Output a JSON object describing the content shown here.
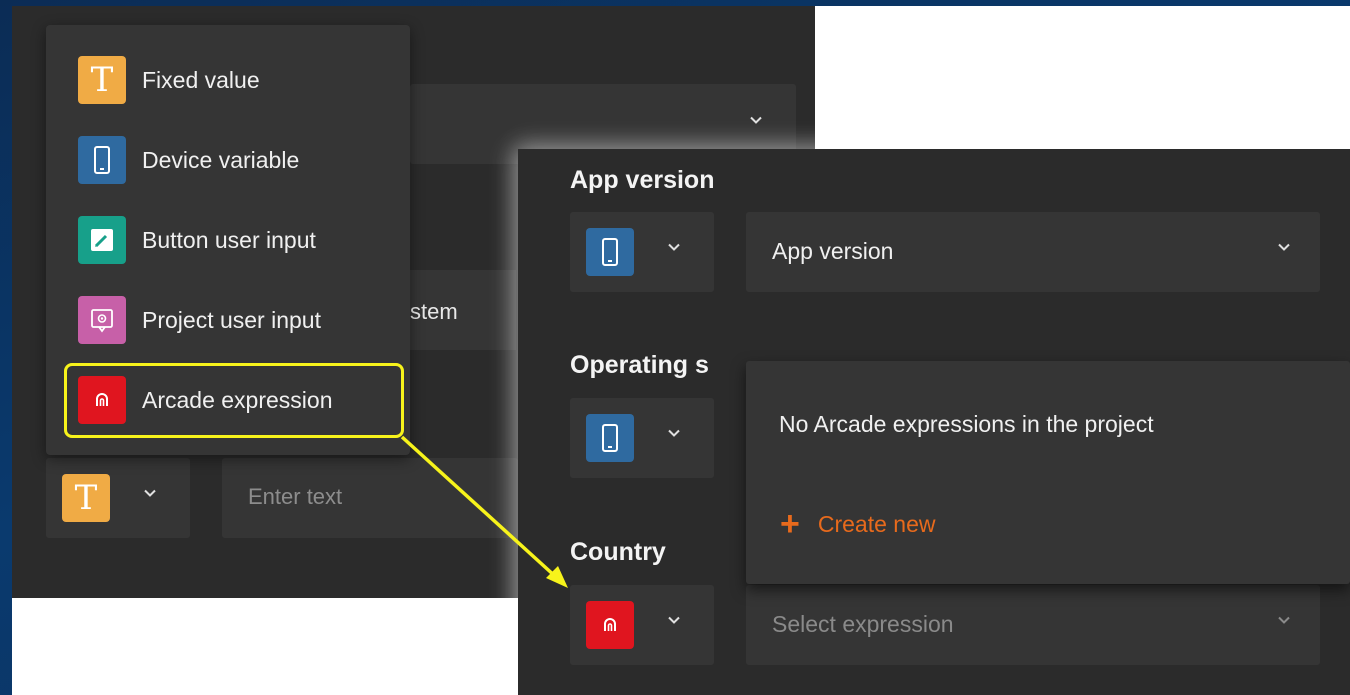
{
  "menu": {
    "items": [
      {
        "label": "Fixed value",
        "icon": "text-T-icon"
      },
      {
        "label": "Device variable",
        "icon": "phone-icon"
      },
      {
        "label": "Button user input",
        "icon": "pencil-icon"
      },
      {
        "label": "Project user input",
        "icon": "gear-screen-icon"
      },
      {
        "label": "Arcade expression",
        "icon": "arcade-icon"
      }
    ]
  },
  "background": {
    "partial_text": "stem",
    "input_placeholder": "Enter text"
  },
  "form": {
    "app_version": {
      "label": "App version",
      "value": "App version"
    },
    "operating_system": {
      "label": "Operating s"
    },
    "country": {
      "label": "Country",
      "placeholder": "Select expression"
    }
  },
  "dropdown": {
    "message": "No Arcade expressions in the project",
    "create_label": "Create new"
  },
  "colors": {
    "panel": "#2b2b2b",
    "field": "#353535",
    "fixed_value": "#f0ab45",
    "device_variable": "#2f6aa0",
    "button_user_input": "#17a08a",
    "project_user_input": "#c760a8",
    "arcade_expression": "#e0151f",
    "accent_orange": "#e86a1c",
    "highlight": "#f7f31b"
  }
}
